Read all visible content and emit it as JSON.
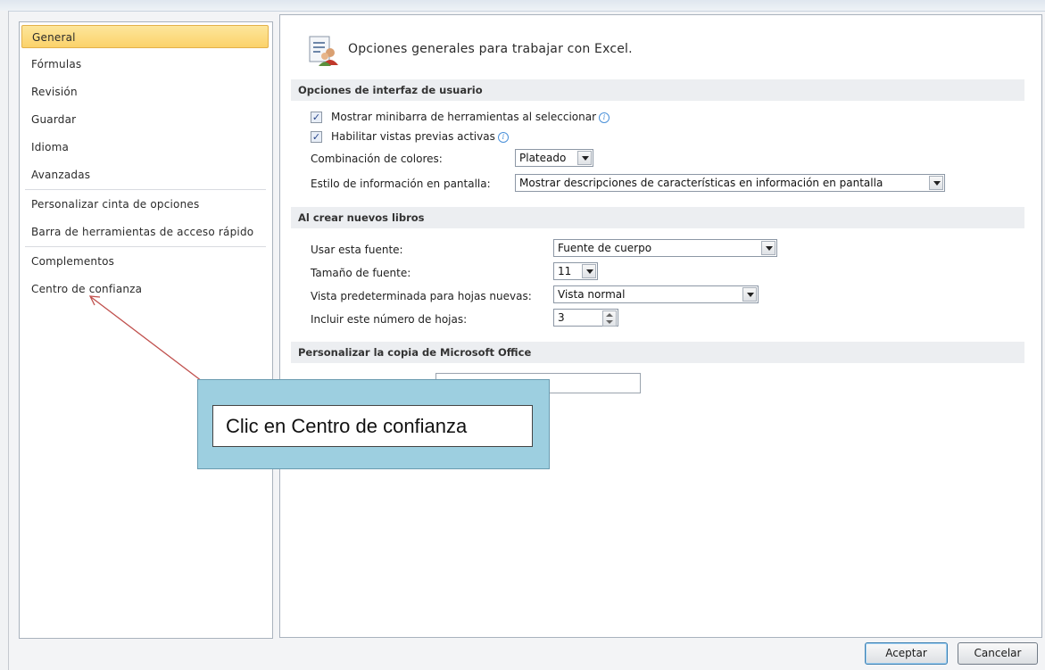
{
  "sidebar": {
    "items": [
      {
        "label": "General"
      },
      {
        "label": "Fórmulas"
      },
      {
        "label": "Revisión"
      },
      {
        "label": "Guardar"
      },
      {
        "label": "Idioma"
      },
      {
        "label": "Avanzadas"
      },
      {
        "label": "Personalizar cinta de opciones"
      },
      {
        "label": "Barra de herramientas de acceso rápido"
      },
      {
        "label": "Complementos"
      },
      {
        "label": "Centro de confianza"
      }
    ],
    "selected": "General"
  },
  "header": {
    "title": "Opciones generales para trabajar con Excel.",
    "icon": "options-people-icon"
  },
  "ui_options": {
    "section_title": "Opciones de interfaz de usuario",
    "minibar": {
      "label": "Mostrar minibarra de herramientas al seleccionar",
      "checked": true
    },
    "live_preview": {
      "label": "Habilitar vistas previas activas",
      "checked": true
    },
    "color_scheme": {
      "label": "Combinación de colores:",
      "value": "Plateado"
    },
    "screentip": {
      "label": "Estilo de información en pantalla:",
      "value": "Mostrar descripciones de características en información en pantalla"
    }
  },
  "new_workbooks": {
    "section_title": "Al crear nuevos libros",
    "font": {
      "label": "Usar esta fuente:",
      "value": "Fuente de cuerpo"
    },
    "font_size": {
      "label": "Tamaño de fuente:",
      "value": "11"
    },
    "default_view": {
      "label": "Vista predeterminada para hojas nuevas:",
      "value": "Vista normal"
    },
    "sheets": {
      "label": "Incluir este número de hojas:",
      "value": "3"
    }
  },
  "personalize": {
    "section_title": "Personalizar la copia de Microsoft Office",
    "user_name": ""
  },
  "callout": {
    "text": "Clic en Centro de confianza"
  },
  "buttons": {
    "ok": "Aceptar",
    "cancel": "Cancelar"
  },
  "colors": {
    "selected_bg": "#fbd26a",
    "callout": "#9dcfe0",
    "arrow": "#c0504d"
  }
}
